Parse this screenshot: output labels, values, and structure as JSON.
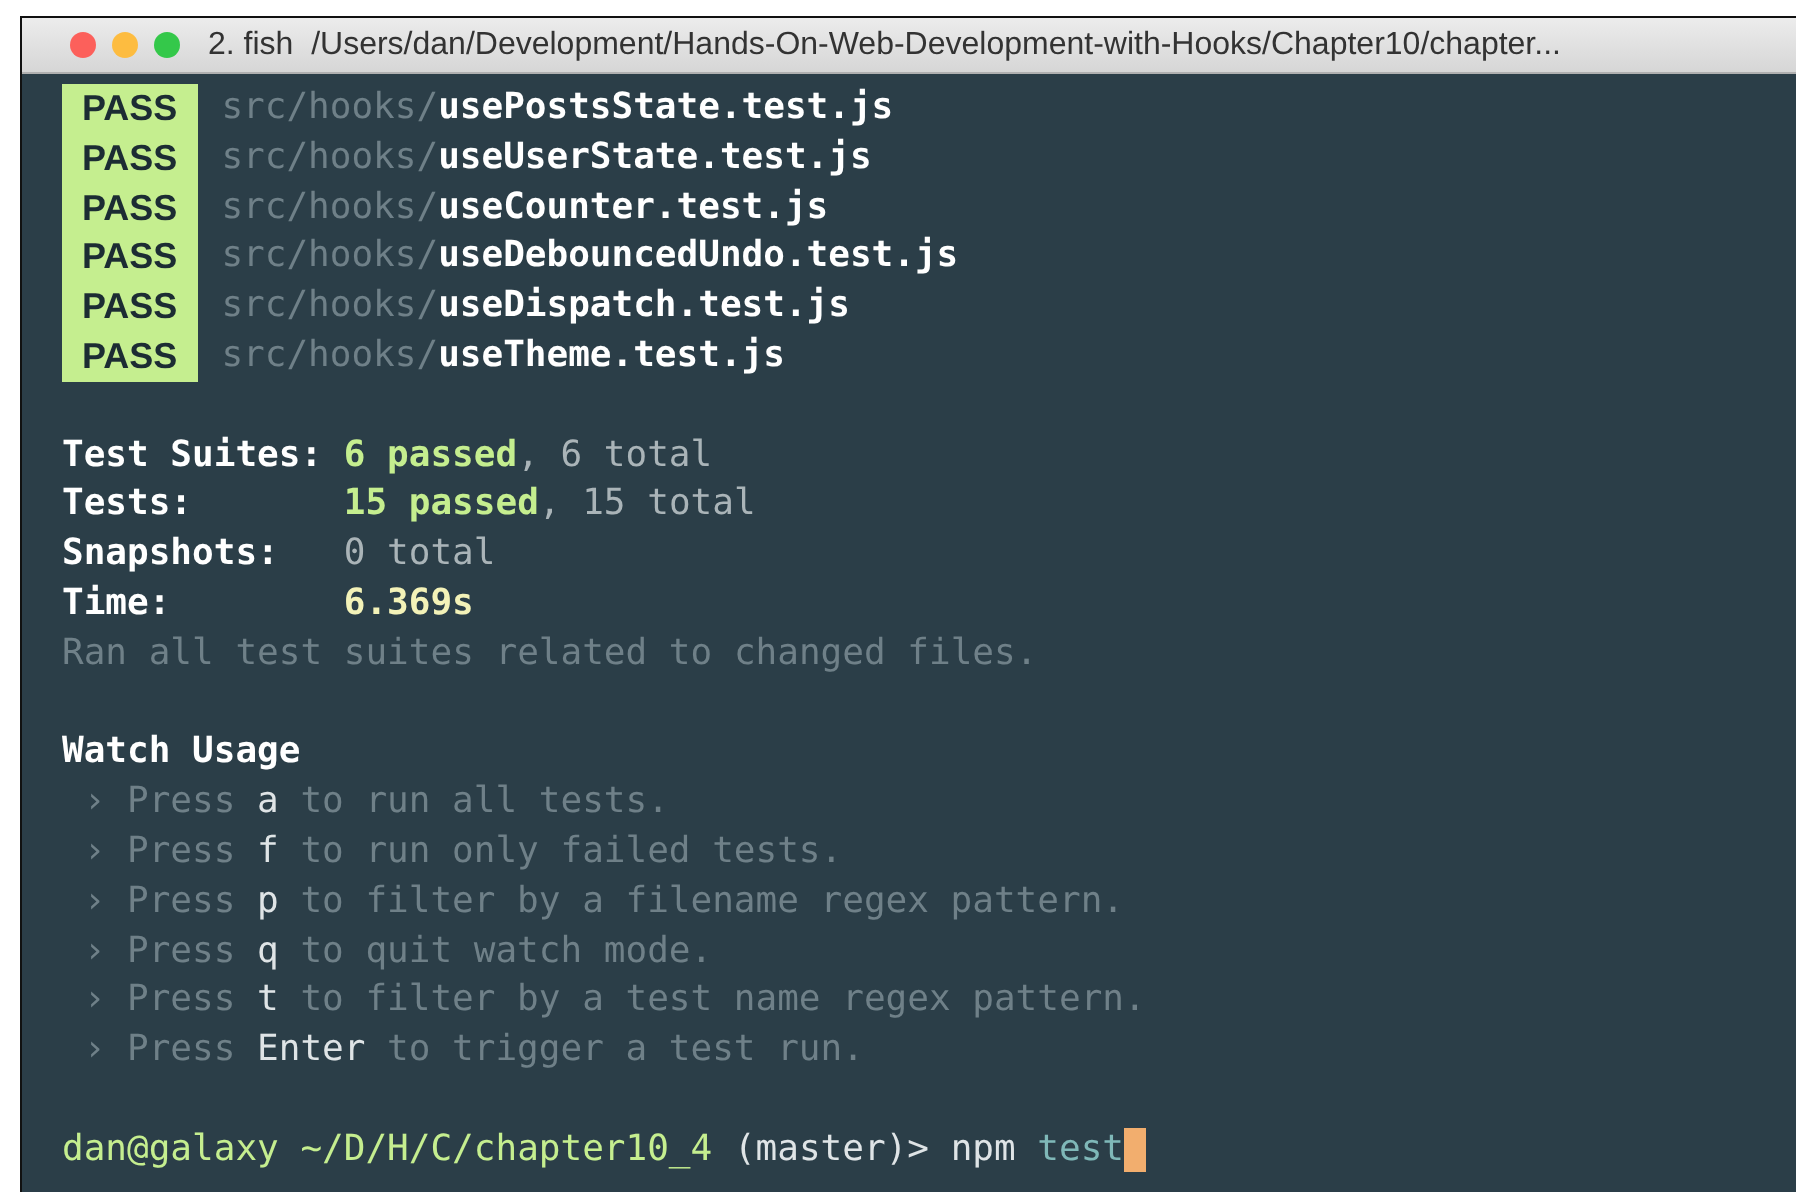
{
  "window": {
    "title": "2. fish  /Users/dan/Development/Hands-On-Web-Development-with-Hooks/Chapter10/chapter..."
  },
  "test_results": [
    {
      "status": "PASS",
      "dir": "src/hooks/",
      "file": "usePostsState.test.js"
    },
    {
      "status": "PASS",
      "dir": "src/hooks/",
      "file": "useUserState.test.js"
    },
    {
      "status": "PASS",
      "dir": "src/hooks/",
      "file": "useCounter.test.js"
    },
    {
      "status": "PASS",
      "dir": "src/hooks/",
      "file": "useDebouncedUndo.test.js"
    },
    {
      "status": "PASS",
      "dir": "src/hooks/",
      "file": "useDispatch.test.js"
    },
    {
      "status": "PASS",
      "dir": "src/hooks/",
      "file": "useTheme.test.js"
    }
  ],
  "summary": [
    {
      "label": "Test Suites:",
      "passed": "6 passed",
      "total": ", 6 total"
    },
    {
      "label": "Tests:",
      "passed": "15 passed",
      "total": ", 15 total"
    },
    {
      "label": "Snapshots:",
      "total": "0 total"
    },
    {
      "label": "Time:",
      "time": "6.369s"
    }
  ],
  "summary_note": "Ran all test suites related to changed files.",
  "watch_usage": {
    "title": "Watch Usage",
    "items": [
      {
        "prefix": "› Press",
        "key": "a",
        "action": "to run all tests."
      },
      {
        "prefix": "› Press",
        "key": "f",
        "action": "to run only failed tests."
      },
      {
        "prefix": "› Press",
        "key": "p",
        "action": "to filter by a filename regex pattern."
      },
      {
        "prefix": "› Press",
        "key": "q",
        "action": "to quit watch mode."
      },
      {
        "prefix": "› Press",
        "key": "t",
        "action": "to filter by a test name regex pattern."
      },
      {
        "prefix": "› Press",
        "key": "Enter",
        "action": "to trigger a test run."
      }
    ]
  },
  "prompt": {
    "user_host": "dan@galaxy",
    "path": "~/D/H/C/chapter10_4",
    "branch": "(master)>",
    "command": "npm",
    "argument": "test"
  }
}
